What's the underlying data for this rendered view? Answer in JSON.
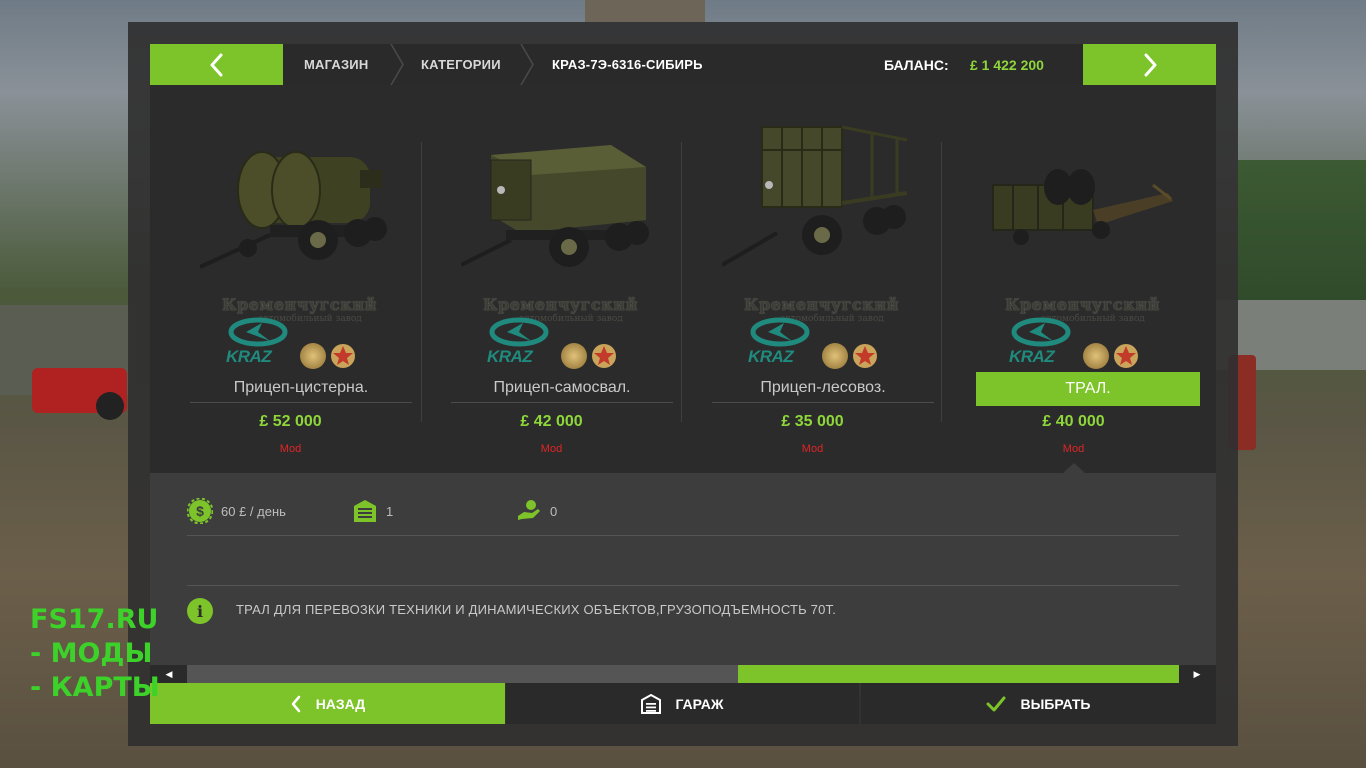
{
  "header": {
    "back_icon": "chevron-left-icon",
    "forward_icon": "chevron-right-icon",
    "breadcrumb": [
      "МАГАЗИН",
      "КАТЕГОРИИ",
      "КРАЗ-7Э-6316-СИБИРЬ"
    ],
    "balance_label": "БАЛАНС:",
    "balance_value": "£ 1 422 200"
  },
  "products": [
    {
      "brand": "Кременчугский",
      "brand_sub": "автомобильный завод",
      "brand_logo": "KRAZ",
      "name": "Прицеп-цистерна.",
      "price": "£ 52 000",
      "tag": "Mod",
      "selected": false,
      "image": "tank-trailer"
    },
    {
      "brand": "Кременчугский",
      "brand_sub": "автомобильный завод",
      "brand_logo": "KRAZ",
      "name": "Прицеп-самосвал.",
      "price": "£ 42 000",
      "tag": "Mod",
      "selected": false,
      "image": "dump-trailer"
    },
    {
      "brand": "Кременчугский",
      "brand_sub": "автомобильный завод",
      "brand_logo": "KRAZ",
      "name": "Прицеп-лесовоз.",
      "price": "£ 35 000",
      "tag": "Mod",
      "selected": false,
      "image": "timber-trailer"
    },
    {
      "brand": "Кременчугский",
      "brand_sub": "автомобильный завод",
      "brand_logo": "KRAZ",
      "name": "ТРАЛ.",
      "price": "£ 40 000",
      "tag": "Mod",
      "selected": true,
      "image": "lowbed-trailer"
    }
  ],
  "details": {
    "upkeep": {
      "icon": "dollar-gear-icon",
      "value": "60 £ / день"
    },
    "garage": {
      "icon": "garage-icon",
      "value": "1"
    },
    "owned": {
      "icon": "hand-icon",
      "value": "0"
    },
    "info_icon": "info-icon",
    "description": "ТРАЛ ДЛЯ ПЕРЕВОЗКИ ТЕХНИКИ И ДИНАМИЧЕСКИХ ОБЪЕКТОВ,ГРУЗОПОДЪЕМНОСТЬ 70Т."
  },
  "scrollbar": {
    "left_arrow": "◀",
    "right_arrow": "▶"
  },
  "footer": {
    "back_label": "НАЗАД",
    "garage_label": "ГАРАЖ",
    "select_label": "ВЫБРАТЬ"
  },
  "watermark": [
    "FS17.RU",
    "- МОДЫ",
    "- КАРТЫ"
  ],
  "colors": {
    "accent": "#7dc42a",
    "price": "#8ed63a",
    "mod_tag": "#e02525",
    "panel": "#2b2b2b"
  }
}
